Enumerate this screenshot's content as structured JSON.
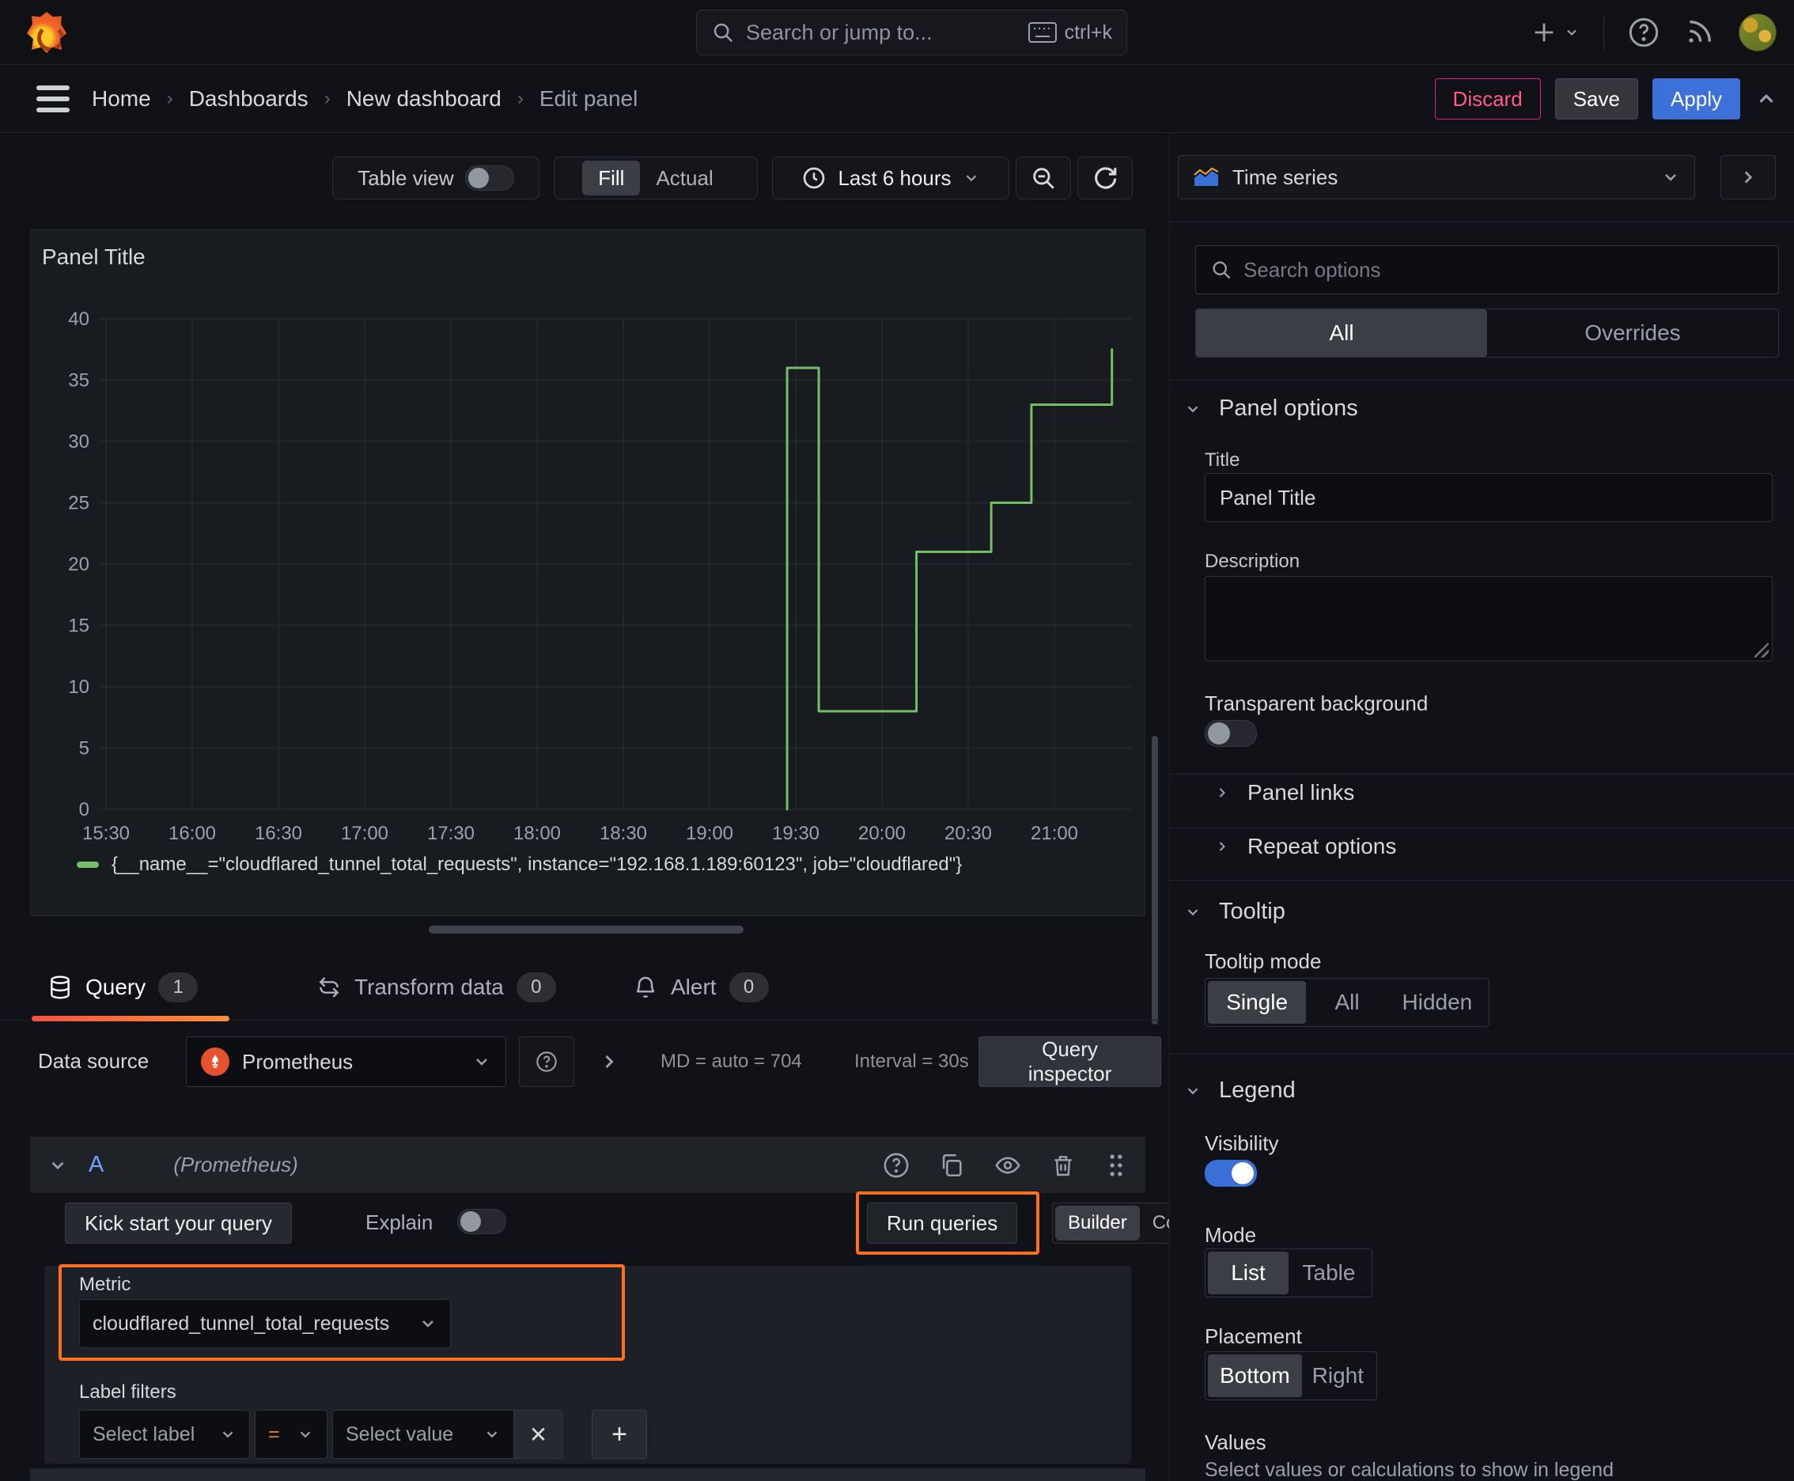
{
  "topbar": {
    "search_placeholder": "Search or jump to...",
    "search_shortcut": "ctrl+k"
  },
  "breadcrumb": {
    "items": [
      "Home",
      "Dashboards",
      "New dashboard",
      "Edit panel"
    ],
    "discard": "Discard",
    "save": "Save",
    "apply": "Apply"
  },
  "panel_toolbar": {
    "table_view": "Table view",
    "fill": "Fill",
    "actual": "Actual",
    "time_range": "Last 6 hours"
  },
  "panel": {
    "title": "Panel Title"
  },
  "chart_data": {
    "type": "line",
    "line_style": "step-after",
    "title": "Panel Title",
    "color": "#73bf69",
    "grid": true,
    "legend_position": "bottom",
    "series_label": "{__name__=\"cloudflared_tunnel_total_requests\", instance=\"192.168.1.189:60123\", job=\"cloudflared\"}",
    "x_ticks": [
      "15:30",
      "16:00",
      "16:30",
      "17:00",
      "17:30",
      "18:00",
      "18:30",
      "19:00",
      "19:30",
      "20:00",
      "20:30",
      "21:00"
    ],
    "y_ticks": [
      0,
      5,
      10,
      15,
      20,
      25,
      30,
      35,
      40
    ],
    "ylim": [
      0,
      40
    ],
    "xlabel": "",
    "ylabel": "",
    "points": [
      {
        "t": "19:27",
        "v": 0
      },
      {
        "t": "19:27",
        "v": 36
      },
      {
        "t": "19:38",
        "v": 36
      },
      {
        "t": "19:38",
        "v": 8
      },
      {
        "t": "20:12",
        "v": 8
      },
      {
        "t": "20:12",
        "v": 21
      },
      {
        "t": "20:38",
        "v": 21
      },
      {
        "t": "20:38",
        "v": 25
      },
      {
        "t": "20:52",
        "v": 25
      },
      {
        "t": "20:52",
        "v": 33
      },
      {
        "t": "21:20",
        "v": 33
      },
      {
        "t": "21:20",
        "v": 37.5
      }
    ]
  },
  "tabs": {
    "query": "Query",
    "query_count": "1",
    "transform": "Transform data",
    "transform_count": "0",
    "alert": "Alert",
    "alert_count": "0"
  },
  "datasource_row": {
    "label": "Data source",
    "name": "Prometheus",
    "stats": "MD = auto = 704",
    "interval": "Interval = 30s",
    "inspector": "Query inspector"
  },
  "query_editor": {
    "ref_id": "A",
    "ds_hint": "(Prometheus)",
    "kickstart": "Kick start your query",
    "explain": "Explain",
    "run_queries": "Run queries",
    "builder": "Builder",
    "code": "Code",
    "metric_label": "Metric",
    "metric_value": "cloudflared_tunnel_total_requests",
    "filters_label": "Label filters",
    "select_label": "Select label",
    "operator": "=",
    "select_value": "Select value"
  },
  "sidebar": {
    "viz_name": "Time series",
    "search_placeholder": "Search options",
    "tab_all": "All",
    "tab_overrides": "Overrides",
    "panel_options": {
      "header": "Panel options",
      "title_label": "Title",
      "title_value": "Panel Title",
      "description_label": "Description",
      "transparent_label": "Transparent background",
      "panel_links": "Panel links",
      "repeat_options": "Repeat options"
    },
    "tooltip": {
      "header": "Tooltip",
      "mode_label": "Tooltip mode",
      "single": "Single",
      "all": "All",
      "hidden": "Hidden"
    },
    "legend": {
      "header": "Legend",
      "visibility_label": "Visibility",
      "mode_label": "Mode",
      "list": "List",
      "table": "Table",
      "placement_label": "Placement",
      "bottom": "Bottom",
      "right": "Right",
      "values_label": "Values",
      "values_desc": "Select values or calculations to show in legend"
    }
  },
  "colors": {
    "accent_orange": "#ff6f1f",
    "series_green": "#73bf69",
    "apply_blue": "#3d71d9",
    "discard_red": "#e0226e"
  }
}
